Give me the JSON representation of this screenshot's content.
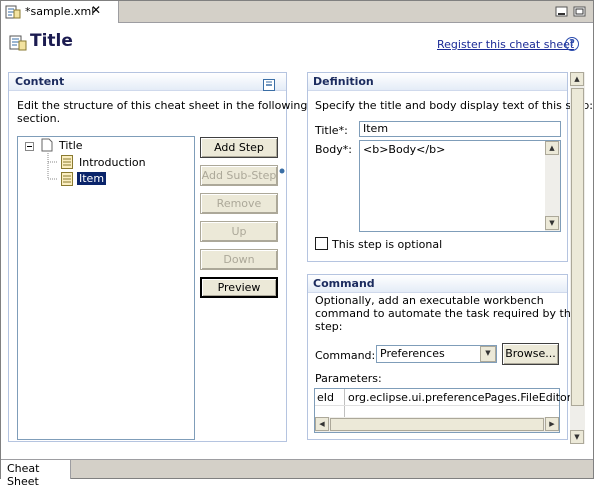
{
  "editor_tab": {
    "label": "*sample.xml",
    "close_glyph": "✕"
  },
  "window_controls": {
    "minimize": "▁",
    "maximize": "□"
  },
  "header": {
    "title": "Title",
    "register_link": "Register this cheat sheet",
    "help": "?"
  },
  "content_section": {
    "title": "Content",
    "description_line1": "Edit the structure of this cheat sheet in the following",
    "description_line2": "section.",
    "tree": {
      "root": "Title",
      "children": [
        "Introduction",
        "Item"
      ],
      "selected": "Item"
    },
    "buttons": {
      "add_step": "Add Step",
      "add_sub_step": "Add Sub-Step",
      "remove": "Remove",
      "up": "Up",
      "down": "Down",
      "preview": "Preview"
    }
  },
  "definition_section": {
    "title": "Definition",
    "description": "Specify the title and body display text of this step:",
    "title_label": "Title*:",
    "title_value": "Item",
    "body_label": "Body*:",
    "body_value": "<b>Body</b>",
    "optional_checkbox": "This step is optional",
    "optional_checked": false
  },
  "command_section": {
    "title": "Command",
    "description_line1": "Optionally, add an executable workbench",
    "description_line2": "command to automate the task required by this",
    "description_line3": "step:",
    "command_label": "Command:",
    "command_value": "Preferences",
    "browse_button": "Browse...",
    "parameters_label": "Parameters:",
    "parameters_row": {
      "name": "eId",
      "value": "org.eclipse.ui.preferencePages.FileEditors"
    }
  },
  "bottom_tabs": {
    "active": "Cheat Sheet"
  },
  "colors": {
    "selection": "#0a246a",
    "link": "#1a2a96",
    "section_title": "#1b2b5e",
    "section_border": "#b5c4e0"
  }
}
